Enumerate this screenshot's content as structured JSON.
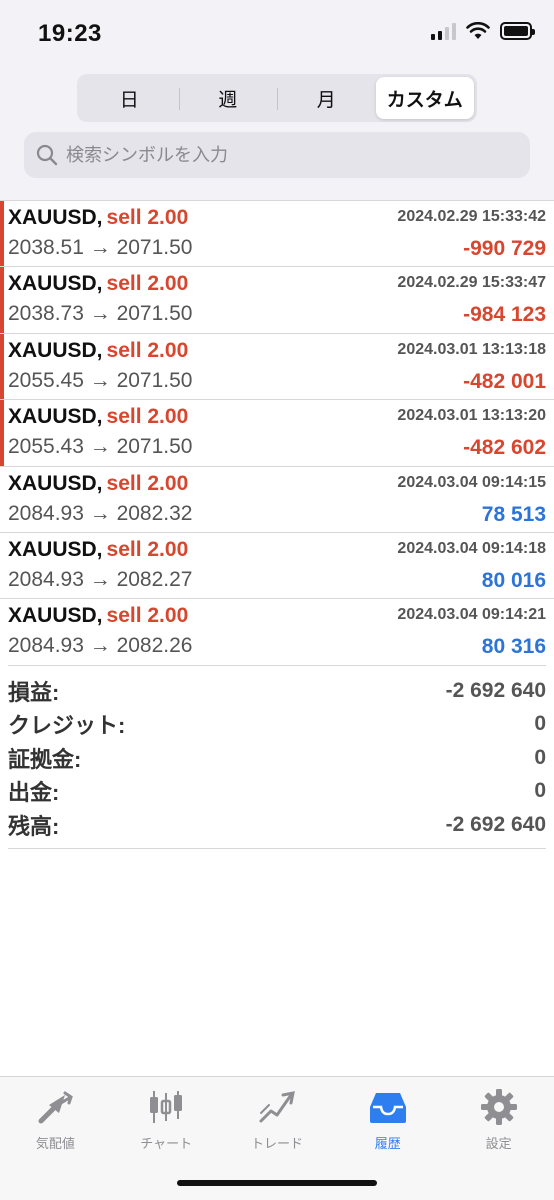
{
  "status": {
    "time": "19:23"
  },
  "period_tabs": [
    {
      "label": "日",
      "active": false
    },
    {
      "label": "週",
      "active": false
    },
    {
      "label": "月",
      "active": false
    },
    {
      "label": "カスタム",
      "active": true
    }
  ],
  "search": {
    "placeholder": "検索シンボルを入力"
  },
  "trades": [
    {
      "symbol": "XAUUSD,",
      "side": "sell 2.00",
      "datetime": "2024.02.29 15:33:42",
      "prices": "2038.51 → 2071.50",
      "profit": "-990 729",
      "result": "loss"
    },
    {
      "symbol": "XAUUSD,",
      "side": "sell 2.00",
      "datetime": "2024.02.29 15:33:47",
      "prices": "2038.73 → 2071.50",
      "profit": "-984 123",
      "result": "loss"
    },
    {
      "symbol": "XAUUSD,",
      "side": "sell 2.00",
      "datetime": "2024.03.01 13:13:18",
      "prices": "2055.45 → 2071.50",
      "profit": "-482 001",
      "result": "loss"
    },
    {
      "symbol": "XAUUSD,",
      "side": "sell 2.00",
      "datetime": "2024.03.01 13:13:20",
      "prices": "2055.43 → 2071.50",
      "profit": "-482 602",
      "result": "loss"
    },
    {
      "symbol": "XAUUSD,",
      "side": "sell 2.00",
      "datetime": "2024.03.04 09:14:15",
      "prices": "2084.93 → 2082.32",
      "profit": "78 513",
      "result": "gain"
    },
    {
      "symbol": "XAUUSD,",
      "side": "sell 2.00",
      "datetime": "2024.03.04 09:14:18",
      "prices": "2084.93 → 2082.27",
      "profit": "80 016",
      "result": "gain"
    },
    {
      "symbol": "XAUUSD,",
      "side": "sell 2.00",
      "datetime": "2024.03.04 09:14:21",
      "prices": "2084.93 → 2082.26",
      "profit": "80 316",
      "result": "gain"
    }
  ],
  "summary": [
    {
      "label": "損益:",
      "value": "-2 692 640"
    },
    {
      "label": "クレジット:",
      "value": "0"
    },
    {
      "label": "証拠金:",
      "value": "0"
    },
    {
      "label": "出金:",
      "value": "0"
    },
    {
      "label": "残高:",
      "value": "-2 692 640"
    }
  ],
  "tabbar": [
    {
      "label": "気配値",
      "icon": "quotes-icon",
      "active": false
    },
    {
      "label": "チャート",
      "icon": "chart-icon",
      "active": false
    },
    {
      "label": "トレード",
      "icon": "trade-icon",
      "active": false
    },
    {
      "label": "履歴",
      "icon": "history-icon",
      "active": true
    },
    {
      "label": "設定",
      "icon": "settings-icon",
      "active": false
    }
  ],
  "colors": {
    "loss": "#d7462e",
    "gain": "#2c74d8",
    "active_tab": "#2f7ef0",
    "inactive_tab": "#8e8e93"
  }
}
